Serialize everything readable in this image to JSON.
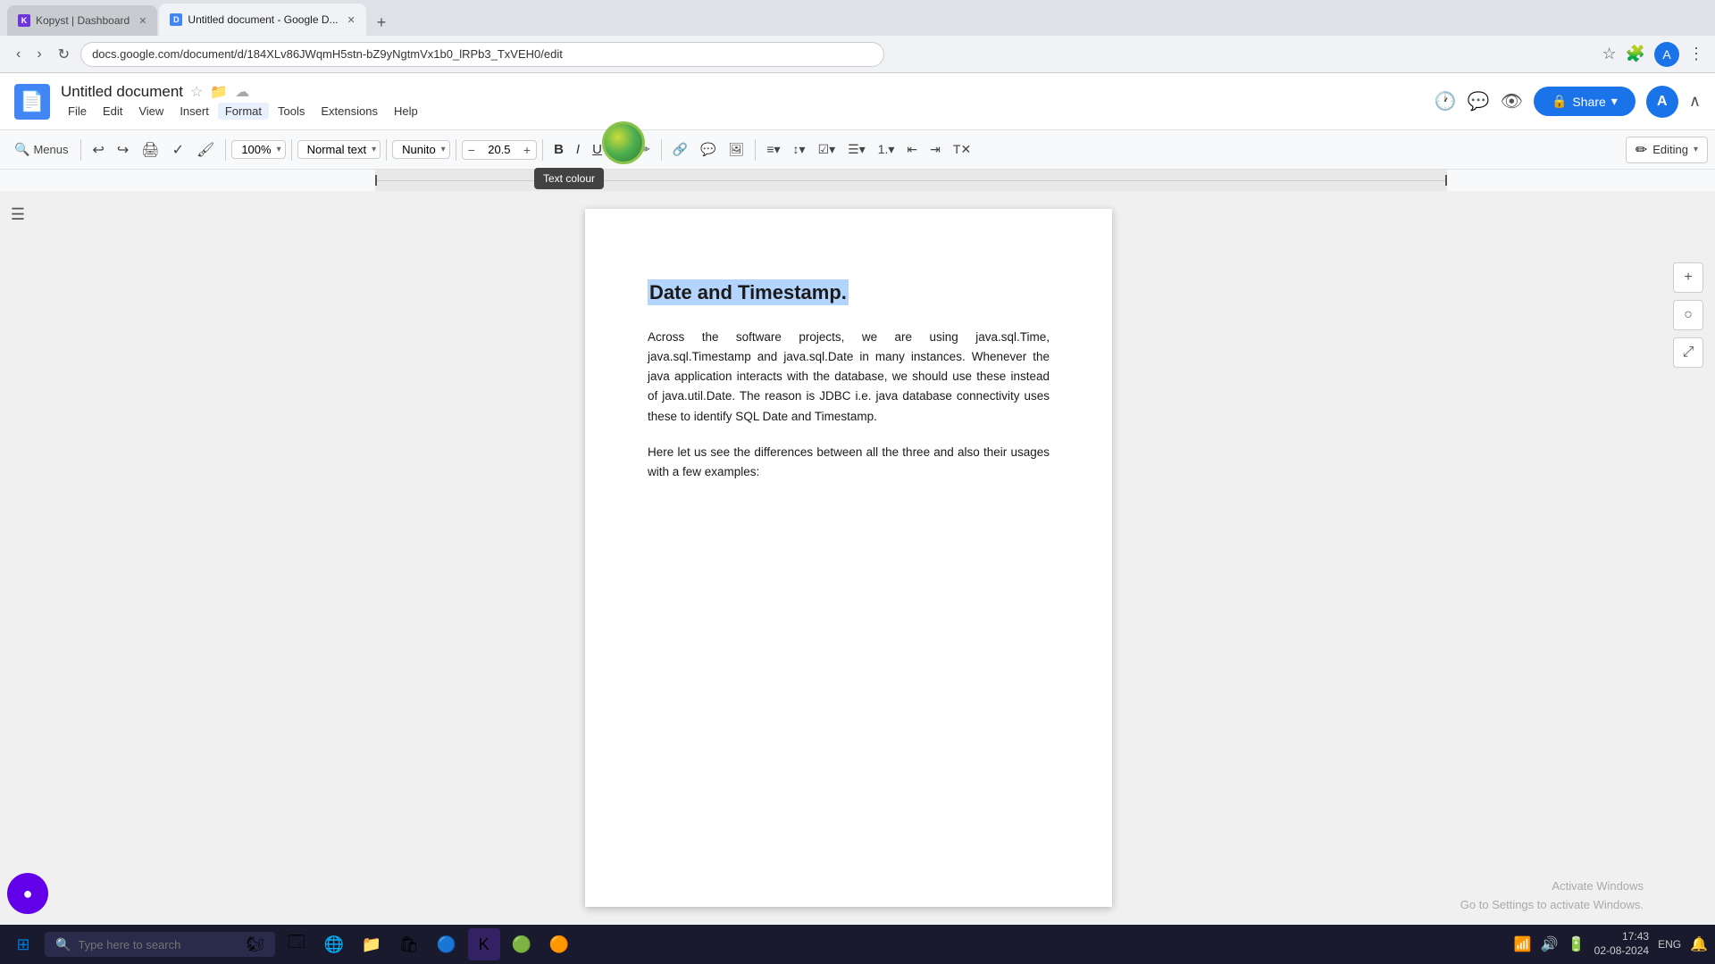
{
  "browser": {
    "tabs": [
      {
        "label": "Kopyst | Dashboard",
        "active": false,
        "favicon": "K"
      },
      {
        "label": "Untitled document - Google D...",
        "active": true,
        "favicon": "D"
      }
    ],
    "address": "docs.google.com/document/d/184XLv86JWqmH5stn-bZ9yNgtmVx1b0_lRPb3_TxVEH0/edit",
    "new_tab_icon": "+"
  },
  "docs": {
    "logo_letter": "D",
    "title": "Untitled document",
    "menu_items": [
      "File",
      "Edit",
      "View",
      "Insert",
      "Format",
      "Tools",
      "Extensions",
      "Help"
    ],
    "toolbar": {
      "menus_label": "Menus",
      "zoom": "100%",
      "style": "Normal text",
      "font": "Nunito",
      "font_size": "20.5",
      "bold": "B",
      "italic": "I",
      "underline": "U"
    },
    "editing_label": "Editing",
    "share_label": "Share"
  },
  "document": {
    "heading": "Date and Timestamp.",
    "paragraph1": "Across the software projects, we are using java.sql.Time, java.sql.Timestamp and java.sql.Date in many instances. Whenever the java application interacts with the database, we should use these instead of java.util.Date. The reason is JDBC i.e. java database connectivity uses these to identify SQL Date and Timestamp.",
    "paragraph2": "Here let us see the differences between all the three and also their usages with a few examples:"
  },
  "tooltip": {
    "text": "Text colour"
  },
  "taskbar": {
    "search_placeholder": "Type here to search",
    "time": "17:43",
    "date": "02-08-2024",
    "language": "ENG"
  },
  "activate_windows": {
    "line1": "Activate Windows",
    "line2": "Go to Settings to activate Windows."
  }
}
